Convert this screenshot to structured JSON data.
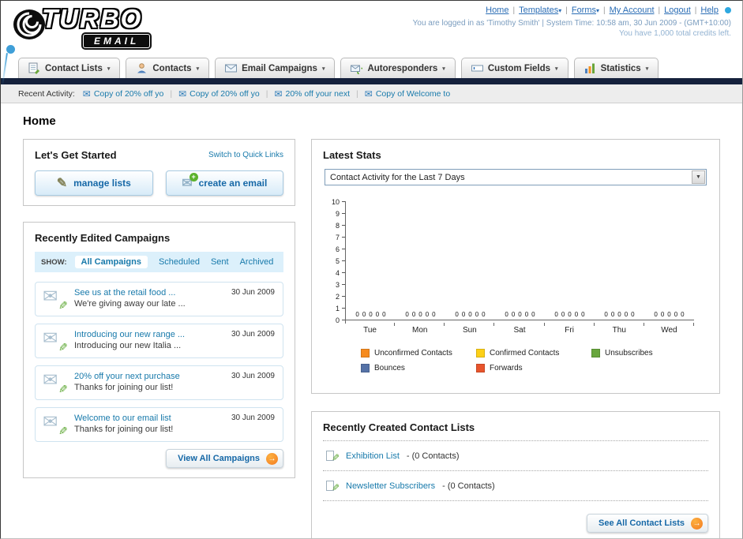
{
  "brand": {
    "name_top": "TURBO",
    "name_bottom": "EMAIL"
  },
  "header": {
    "links": [
      {
        "label": "Home"
      },
      {
        "label": "Templates",
        "dropdown": true
      },
      {
        "label": "Forms",
        "dropdown": true
      },
      {
        "label": "My Account"
      },
      {
        "label": "Logout"
      },
      {
        "label": "Help"
      }
    ],
    "login_info": "You are logged in as 'Timothy Smith' | System Time: 10:58 am, 30 Jun 2009 - (GMT+10:00)",
    "credits_info": "You have 1,000 total credits left."
  },
  "nav": {
    "tabs": [
      {
        "label": "Contact Lists",
        "icon": "contact-lists-icon"
      },
      {
        "label": "Contacts",
        "icon": "contacts-icon"
      },
      {
        "label": "Email Campaigns",
        "icon": "email-campaigns-icon"
      },
      {
        "label": "Autoresponders",
        "icon": "autoresponders-icon"
      },
      {
        "label": "Custom Fields",
        "icon": "custom-fields-icon"
      },
      {
        "label": "Statistics",
        "icon": "statistics-icon"
      }
    ]
  },
  "activity": {
    "label": "Recent Activity:",
    "items": [
      "Copy of 20% off yo",
      "Copy of 20% off yo",
      "20% off your next",
      "Copy of Welcome to"
    ]
  },
  "page": {
    "title": "Home"
  },
  "get_started": {
    "title": "Let's Get Started",
    "switch_link": "Switch to Quick Links",
    "manage_lists_label": "manage lists",
    "create_email_label": "create an email"
  },
  "campaigns": {
    "title": "Recently Edited Campaigns",
    "show_label": "SHOW:",
    "filters": [
      "All Campaigns",
      "Scheduled",
      "Sent",
      "Archived"
    ],
    "selected_filter": "All Campaigns",
    "items": [
      {
        "title": "See us at the retail food ...",
        "subtitle": "We're giving away our late ...",
        "date": "30 Jun 2009"
      },
      {
        "title": "Introducing our new range ...",
        "subtitle": "Introducing our new Italia ...",
        "date": "30 Jun 2009"
      },
      {
        "title": "20% off your next purchase",
        "subtitle": "Thanks for joining our list!",
        "date": "30 Jun 2009"
      },
      {
        "title": "Welcome to our email list",
        "subtitle": "Thanks for joining our list!",
        "date": "30 Jun 2009"
      }
    ],
    "view_all_label": "View All Campaigns"
  },
  "stats": {
    "title": "Latest Stats",
    "period_selected": "Contact Activity for the Last 7 Days"
  },
  "chart_data": {
    "type": "bar",
    "title": "Contact Activity for the Last 7 Days",
    "categories": [
      "Tue",
      "Mon",
      "Sun",
      "Sat",
      "Fri",
      "Thu",
      "Wed"
    ],
    "series": [
      {
        "name": "Unconfirmed Contacts",
        "color": "#f68b1f",
        "values": [
          0,
          0,
          0,
          0,
          0,
          0,
          0
        ]
      },
      {
        "name": "Confirmed Contacts",
        "color": "#fdd017",
        "values": [
          0,
          0,
          0,
          0,
          0,
          0,
          0
        ]
      },
      {
        "name": "Unsubscribes",
        "color": "#68a63d",
        "values": [
          0,
          0,
          0,
          0,
          0,
          0,
          0
        ]
      },
      {
        "name": "Bounces",
        "color": "#5572a7",
        "values": [
          0,
          0,
          0,
          0,
          0,
          0,
          0
        ]
      },
      {
        "name": "Forwards",
        "color": "#e8542c",
        "values": [
          0,
          0,
          0,
          0,
          0,
          0,
          0
        ]
      }
    ],
    "xlabel": "",
    "ylabel": "",
    "ylim": [
      0,
      10
    ],
    "y_ticks": [
      0,
      1,
      2,
      3,
      4,
      5,
      6,
      7,
      8,
      9,
      10
    ],
    "grid": false,
    "legend_position": "bottom"
  },
  "contact_lists": {
    "title": "Recently Created Contact Lists",
    "items": [
      {
        "name": "Exhibition List",
        "suffix": "- (0 Contacts)"
      },
      {
        "name": "Newsletter Subscribers",
        "suffix": "- (0 Contacts)"
      }
    ],
    "see_all_label": "See All Contact Lists"
  }
}
